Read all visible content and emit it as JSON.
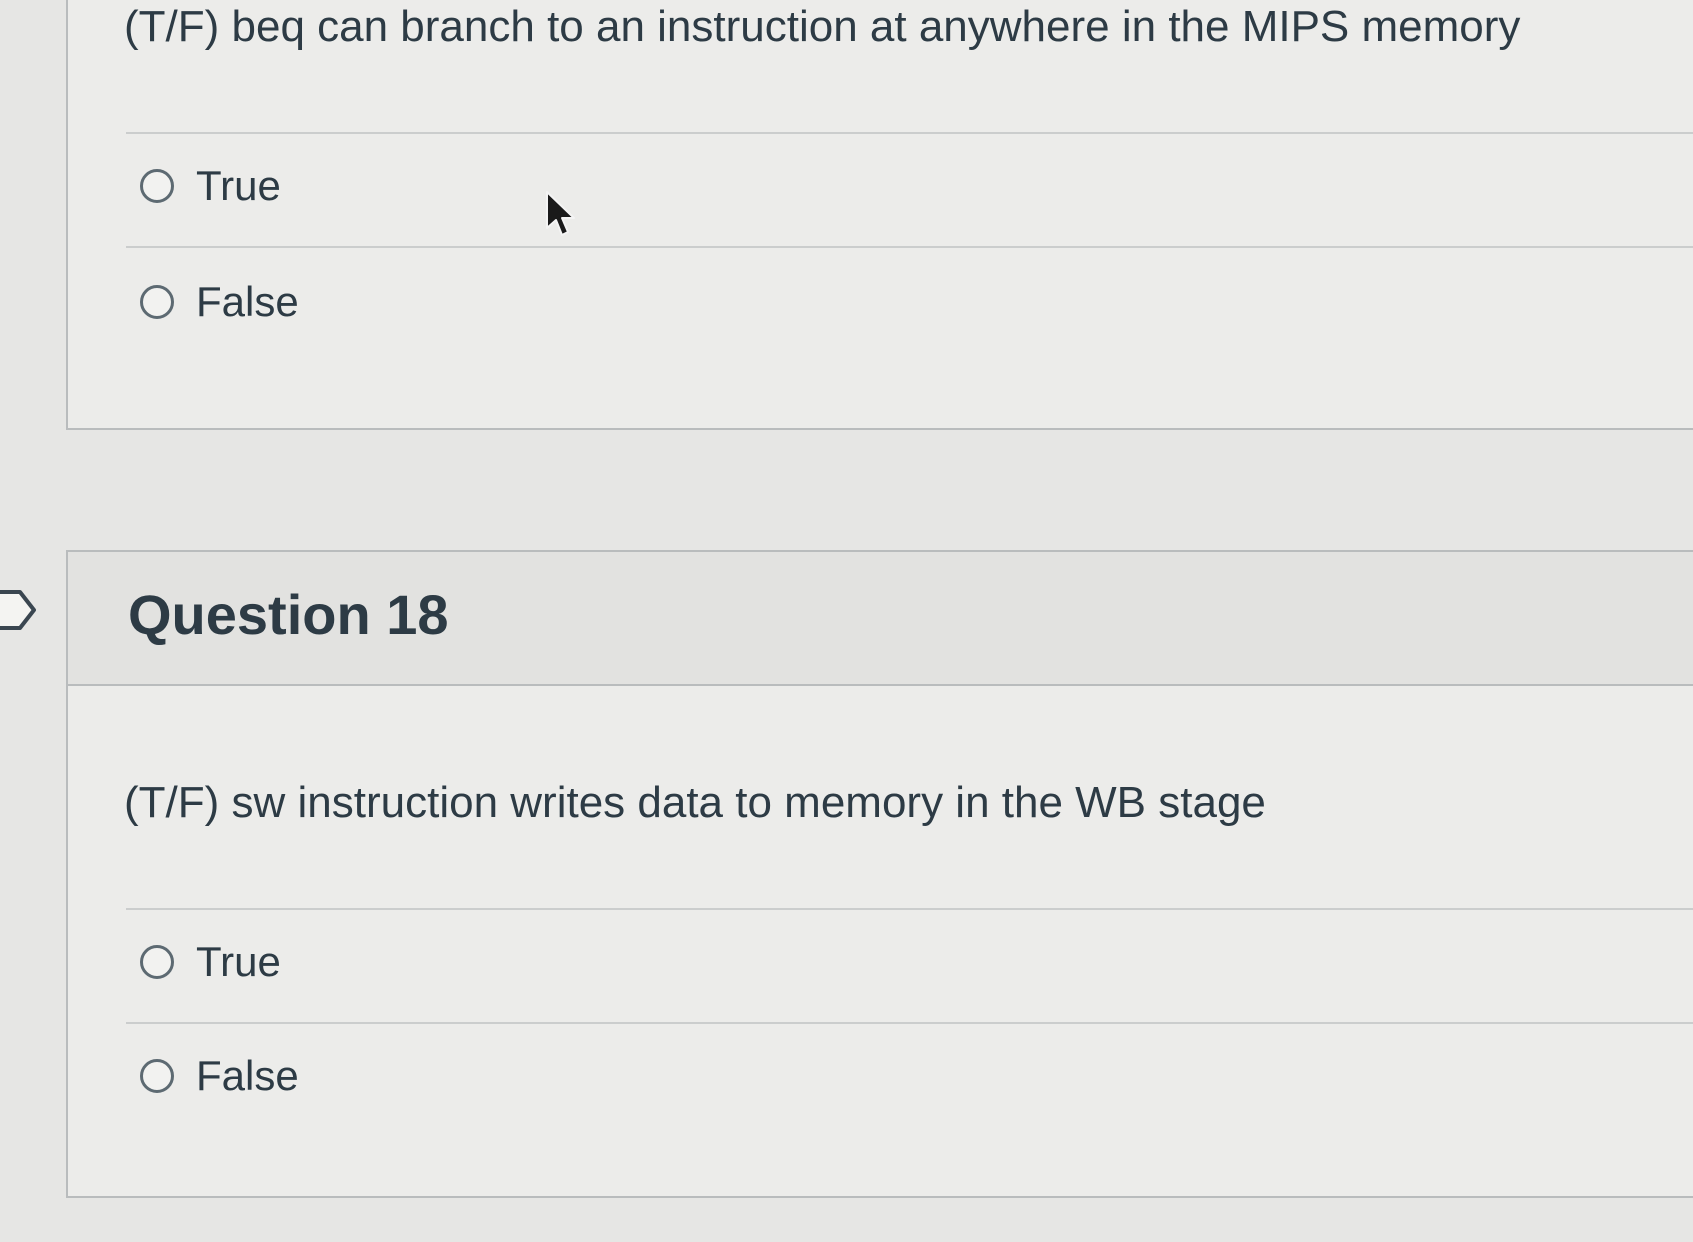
{
  "previous_question": {
    "text": "(T/F) beq can branch to an instruction at anywhere in the MIPS memory",
    "answers": [
      {
        "label": "True",
        "selected": false
      },
      {
        "label": "False",
        "selected": false
      }
    ]
  },
  "question_18": {
    "title": "Question 18",
    "text": "(T/F) sw instruction writes data to memory in the WB stage",
    "answers": [
      {
        "label": "True",
        "selected": false
      },
      {
        "label": "False",
        "selected": false
      }
    ]
  },
  "icons": {
    "flag": "flag-outline-icon",
    "cursor": "mouse-pointer-icon"
  },
  "colors": {
    "background": "#e6e6e4",
    "card": "#ececea",
    "header": "#e2e2e0",
    "text": "#2d3b45",
    "border": "#b9bcbd"
  }
}
